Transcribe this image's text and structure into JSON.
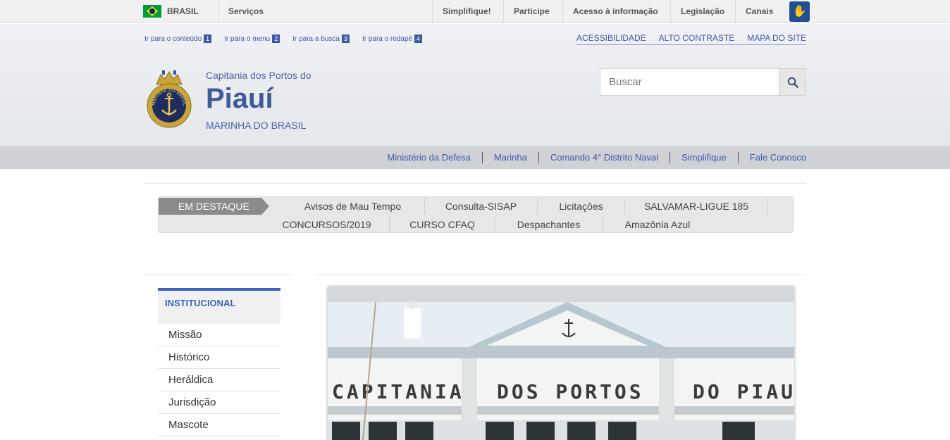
{
  "gov_bar": {
    "country": "BRASIL",
    "services": "Serviços",
    "items": [
      "Simplifique!",
      "Participe",
      "Acesso à informação",
      "Legislação",
      "Canais"
    ],
    "accessibility_icon": "hand-sign-icon"
  },
  "skip_links": [
    {
      "label": "Ir para o conteúdo",
      "num": "1"
    },
    {
      "label": "Ir para o menu",
      "num": "2"
    },
    {
      "label": "Ir para a busca",
      "num": "3"
    },
    {
      "label": "Ir para o rodapé",
      "num": "4"
    }
  ],
  "accessibility_links": [
    "ACESSIBILIDADE",
    "ALTO CONTRASTE",
    "MAPA DO SITE"
  ],
  "site": {
    "subtitle": "Capitania dos Portos do",
    "title": "Piauí",
    "org": "MARINHA DO BRASIL",
    "logo_text": "MARINHA DO BRASIL"
  },
  "search": {
    "placeholder": "Buscar",
    "icon": "search-icon"
  },
  "service_links": [
    "Ministério da Defesa",
    "Marinha",
    "Comando 4° Distrito Naval",
    "Simplifique",
    "Fale Conosco"
  ],
  "destaque": {
    "tag": "EM DESTAQUE",
    "row1": [
      "Avisos de Mau Tempo",
      "Consulta-SISAP",
      "Licitações",
      "SALVAMAR-LIGUE 185"
    ],
    "row2": [
      "CONCURSOS/2019",
      "CURSO CFAQ",
      "Despachantes",
      "Amazônia Azul"
    ]
  },
  "sidebar": {
    "heading": "INSTITUCIONAL",
    "items": [
      "Missão",
      "Histórico",
      "Heráldica",
      "Jurisdição",
      "Mascote"
    ]
  },
  "photo": {
    "sign_words": [
      "CAPITANIA",
      "DOS PORTOS",
      "DO PIAUÍ"
    ]
  },
  "colors": {
    "link": "#3d5aa8",
    "accent": "#3c62bf",
    "title": "#3f5a9a"
  }
}
